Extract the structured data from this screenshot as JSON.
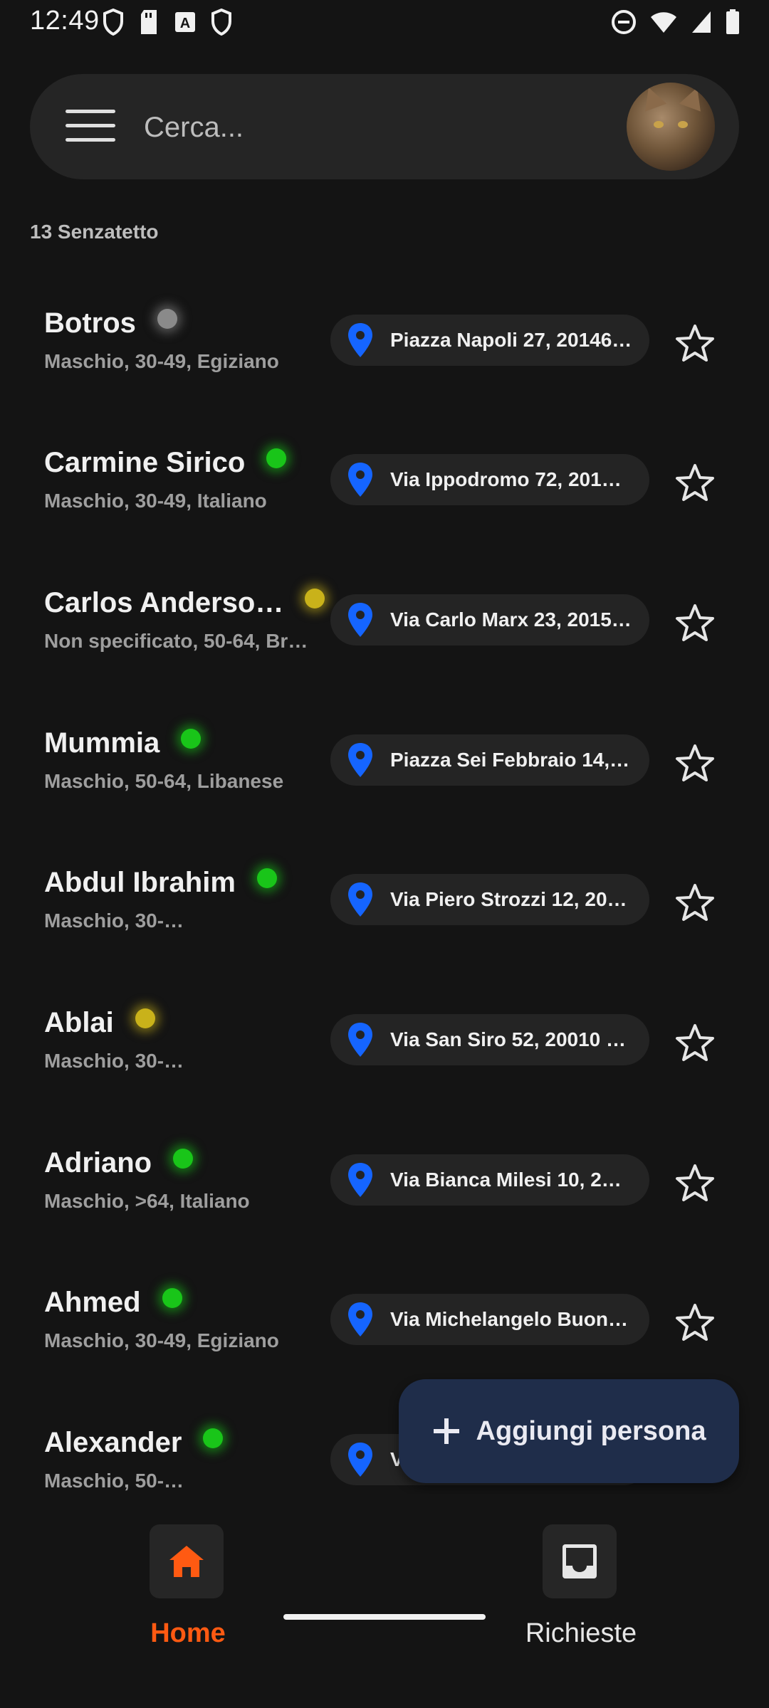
{
  "status_bar": {
    "time": "12:49",
    "left_icons": [
      "shield-icon",
      "sd-card-icon",
      "app-a-icon",
      "shield-icon"
    ],
    "right_icons": [
      "do-not-disturb-icon",
      "wifi-icon",
      "cellular-signal-icon",
      "battery-icon"
    ]
  },
  "search": {
    "placeholder": "Cerca...",
    "menu_icon": "hamburger-menu-icon",
    "avatar": "cat-profile-avatar"
  },
  "list": {
    "count_label": "13 Senzatetto",
    "people": [
      {
        "name": "Botros",
        "meta": "Maschio, 30-49,  Egiziano",
        "status": "grey",
        "address": "Piazza Napoli 27, 20146…"
      },
      {
        "name": "Carmine Sirico",
        "meta": "Maschio, 30-49,  Italiano",
        "status": "green",
        "address": "Via Ippodromo 72, 2015…"
      },
      {
        "name": "Carlos Anderso…",
        "meta": "Non specificato, 50-64,  Br…",
        "status": "yellow",
        "address": "Via Carlo Marx 23, 2015…"
      },
      {
        "name": "Mummia",
        "meta": "Maschio, 50-64,  Libanese",
        "status": "green",
        "address": "Piazza Sei Febbraio 14, …"
      },
      {
        "name": "Abdul Ibrahim",
        "meta": "Maschio, 30-…",
        "status": "green",
        "address": "Via Piero Strozzi 12, 20…"
      },
      {
        "name": "Ablai",
        "meta": "Maschio, 30-…",
        "status": "yellow",
        "address": "Via San Siro 52, 20010 …"
      },
      {
        "name": "Adriano",
        "meta": "Maschio, >64,  Italiano",
        "status": "green",
        "address": "Via Bianca Milesi 10, 20…"
      },
      {
        "name": "Ahmed",
        "meta": "Maschio, 30-49,  Egiziano",
        "status": "green",
        "address": "Via Michelangelo Buona…"
      },
      {
        "name": "Alexander",
        "meta": "Maschio, 50-…",
        "status": "green",
        "address": "V"
      }
    ]
  },
  "fab": {
    "label": "Aggiungi persona",
    "icon": "plus-icon"
  },
  "bottom_nav": {
    "items": [
      {
        "label": "Home",
        "icon": "home-icon",
        "active": true
      },
      {
        "label": "Richieste",
        "icon": "inbox-icon",
        "active": false
      }
    ]
  },
  "colors": {
    "background": "#141414",
    "accent": "#ff5a12",
    "pin": "#1565ff",
    "status_green": "#19c519",
    "status_yellow": "#c9b21a",
    "status_grey": "#8a8a8a",
    "fab": "#1f2d4a"
  }
}
